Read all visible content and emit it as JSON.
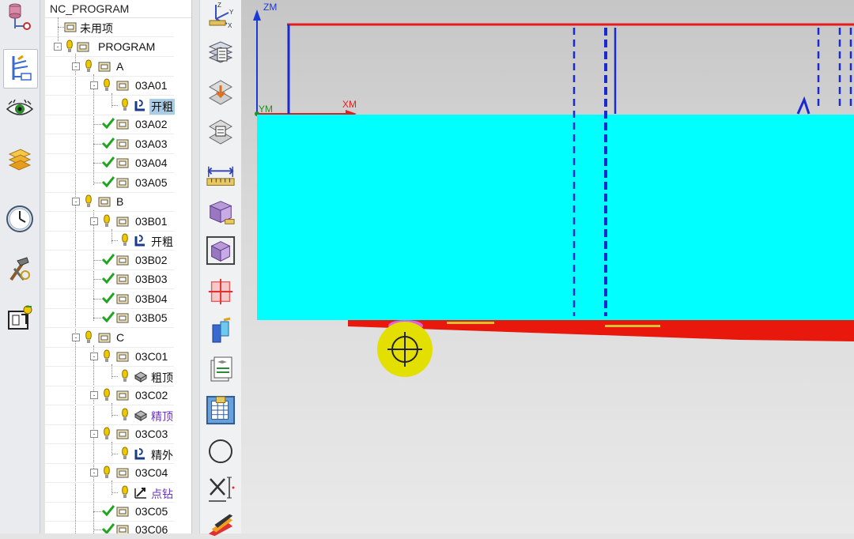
{
  "navigator": {
    "title": "NC_PROGRAM",
    "rows": [
      {
        "label": "未用项"
      },
      {
        "label": "PROGRAM"
      },
      {
        "label": "A"
      },
      {
        "label": "03A01"
      },
      {
        "label": "开粗"
      },
      {
        "label": "03A02"
      },
      {
        "label": "03A03"
      },
      {
        "label": "03A04"
      },
      {
        "label": "03A05"
      },
      {
        "label": "B"
      },
      {
        "label": "03B01"
      },
      {
        "label": "开粗"
      },
      {
        "label": "03B02"
      },
      {
        "label": "03B03"
      },
      {
        "label": "03B04"
      },
      {
        "label": "03B05"
      },
      {
        "label": "C"
      },
      {
        "label": "03C01"
      },
      {
        "label": "粗顶"
      },
      {
        "label": "03C02"
      },
      {
        "label": "精顶"
      },
      {
        "label": "03C03"
      },
      {
        "label": "精外"
      },
      {
        "label": "03C04"
      },
      {
        "label": "点钻"
      },
      {
        "label": "03C05"
      },
      {
        "label": "03C06"
      }
    ]
  },
  "viewport": {
    "axes": {
      "zm": "ZM",
      "xm": "XM",
      "ym": "YM",
      "triad_z": "Z",
      "triad_y": "Y",
      "triad_x": "X"
    }
  },
  "colors": {
    "part": "#00ffff",
    "fixture": "#e8180c",
    "toolpath": "#1030d8",
    "cursor": "#e3df00",
    "check": "#1fa51f",
    "bulb": "#f0c800"
  }
}
